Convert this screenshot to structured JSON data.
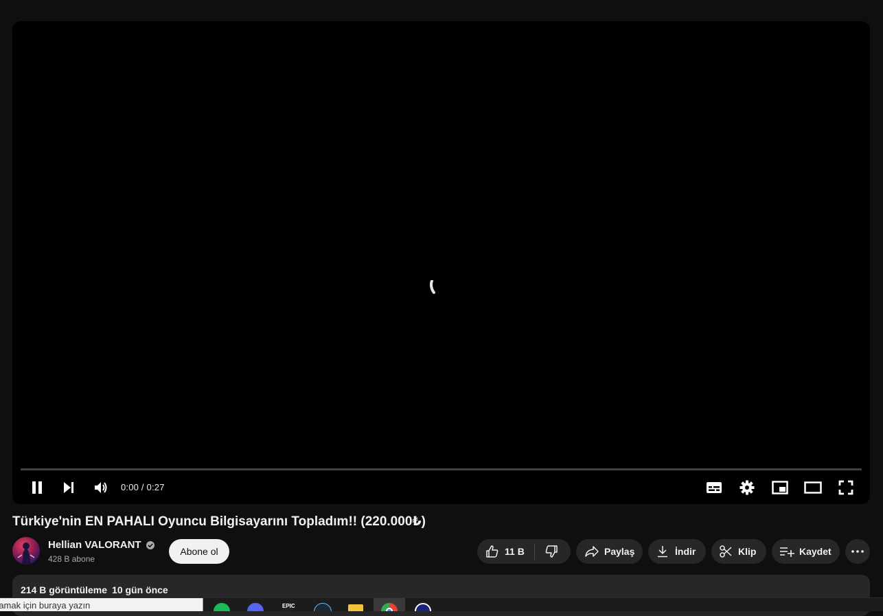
{
  "player": {
    "time_display": "0:00 / 0:27",
    "progress_fraction": 0.0
  },
  "video": {
    "title": "Türkiye'nin EN PAHALI Oyuncu Bilgisayarını Topladım!! (220.000₺)"
  },
  "channel": {
    "name": "Hellian VALORANT",
    "subscribers": "428 B abone",
    "subscribe_label": "Abone ol",
    "verified": true
  },
  "actions": {
    "like_count": "11 B",
    "share_label": "Paylaş",
    "download_label": "İndir",
    "clip_label": "Klip",
    "save_label": "Kaydet"
  },
  "description": {
    "views": "214 B görüntüleme",
    "date": "10 gün önce"
  },
  "taskbar": {
    "search_placeholder": "ramak için buraya yazın",
    "apps": [
      "spotify-icon",
      "discord-icon",
      "epic-games-icon",
      "steam-icon",
      "file-explorer-icon",
      "chrome-icon",
      "app-icon"
    ]
  },
  "colors": {
    "background": "#0f0f0f",
    "player": "#000000",
    "pill": "#272727",
    "subscribe": "#f1f1f1",
    "text": "#f1f1f1",
    "secondary_text": "#aaaaaa"
  }
}
